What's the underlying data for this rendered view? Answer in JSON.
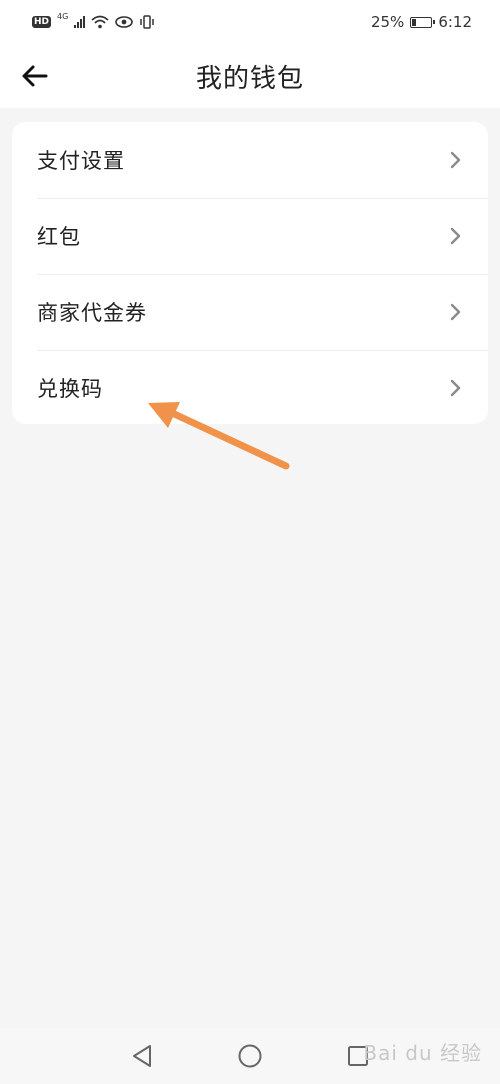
{
  "status_bar": {
    "badge": "HD",
    "network": "4G",
    "battery_percent": "25%",
    "battery_level": 0.25,
    "time": "6:12"
  },
  "header": {
    "title": "我的钱包",
    "back_icon": "arrow-left-icon"
  },
  "menu": {
    "items": [
      {
        "label": "支付设置",
        "icon": "chevron-right-icon"
      },
      {
        "label": "红包",
        "icon": "chevron-right-icon"
      },
      {
        "label": "商家代金券",
        "icon": "chevron-right-icon"
      },
      {
        "label": "兑换码",
        "icon": "chevron-right-icon"
      }
    ]
  },
  "annotation": {
    "icon": "arrow-annotation",
    "color": "#f0924a"
  },
  "nav_bar": {
    "back": "triangle-back-icon",
    "home": "circle-home-icon",
    "recents": "square-recents-icon"
  },
  "watermark": {
    "text": "Bai du 经验"
  }
}
